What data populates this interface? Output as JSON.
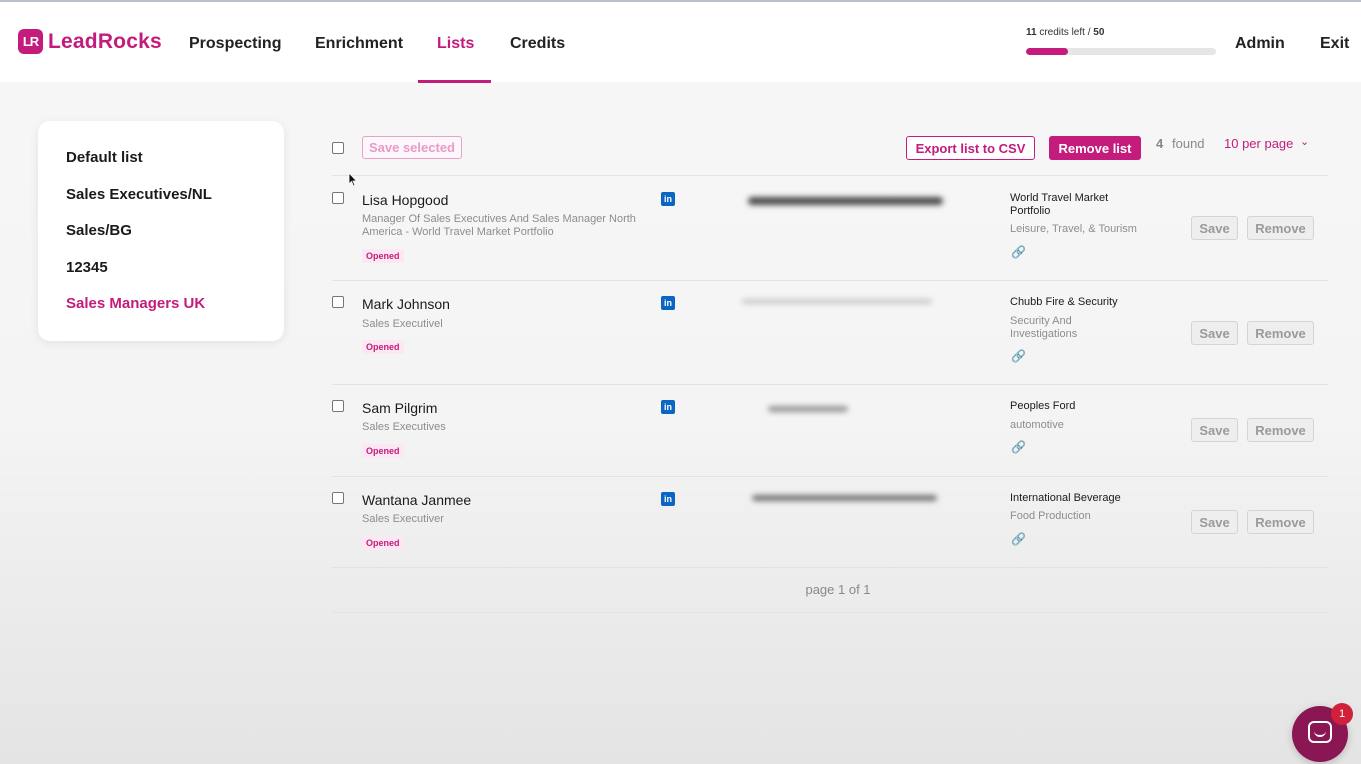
{
  "header": {
    "logo_mark": "LR",
    "logo_text": "LeadRocks",
    "nav": [
      "Prospecting",
      "Enrichment",
      "Lists",
      "Credits"
    ],
    "active_nav": "Lists",
    "credits": {
      "used": "11",
      "text": " credits left / ",
      "total": "50",
      "fraction": 0.22
    },
    "admin": "Admin",
    "exit": "Exit"
  },
  "sidebar": {
    "items": [
      "Default list",
      "Sales Executives/NL",
      "Sales/BG",
      "12345",
      "Sales Managers UK"
    ],
    "active": "Sales Managers UK"
  },
  "toolbar": {
    "save_selected": "Save selected",
    "export_csv": "Export list to CSV",
    "remove_list": "Remove list",
    "found_count": "4",
    "found_label": "found",
    "per_page": "10 per page"
  },
  "rows": [
    {
      "name": "Lisa Hopgood",
      "title": "Manager Of Sales Executives And Sales Manager North America - World Travel Market Portfolio",
      "status": "Opened",
      "linkedin": "in",
      "company": "World Travel Market Portfolio",
      "industry": "Leisure, Travel, & Tourism"
    },
    {
      "name": "Mark Johnson",
      "title": "Sales Executivel",
      "status": "Opened",
      "linkedin": "in",
      "company": "Chubb Fire & Security",
      "industry": "Security And Investigations"
    },
    {
      "name": "Sam Pilgrim",
      "title": "Sales Executives",
      "status": "Opened",
      "linkedin": "in",
      "company": "Peoples Ford",
      "industry": "automotive"
    },
    {
      "name": "Wantana Janmee",
      "title": "Sales Executiver",
      "status": "Opened",
      "linkedin": "in",
      "company": "International Beverage",
      "industry": "Food Production"
    }
  ],
  "row_actions": {
    "save": "Save",
    "remove": "Remove"
  },
  "pager": "page 1 of 1",
  "chat": {
    "badge": "1"
  },
  "colors": {
    "brand": "#c31c7c",
    "linkedin": "#0a66c2",
    "chat": "#8a1653",
    "badge": "#d1203a"
  }
}
